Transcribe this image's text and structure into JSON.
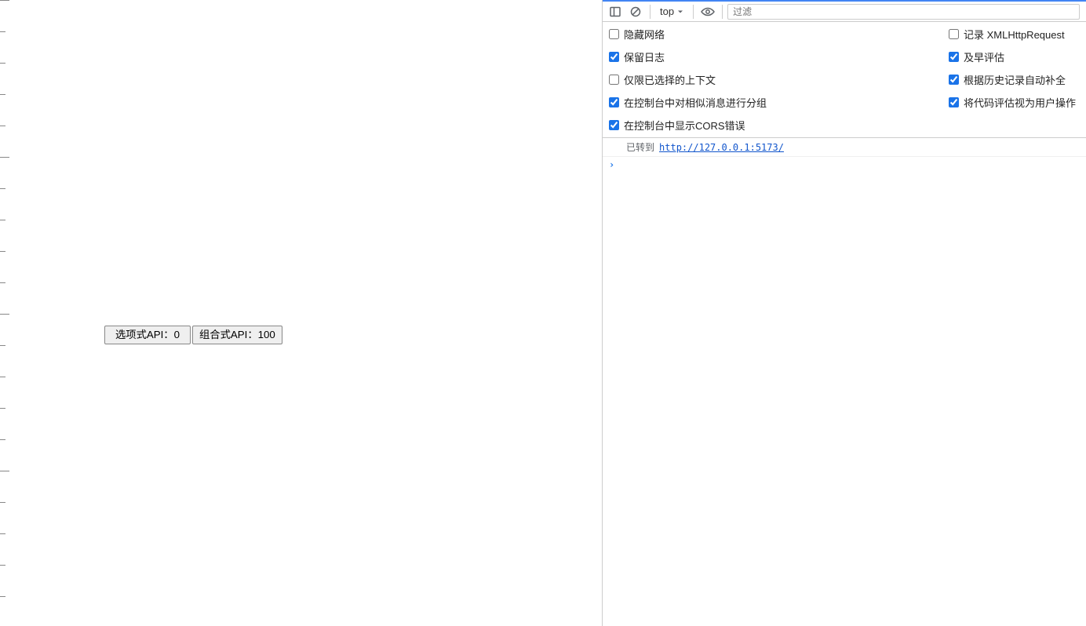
{
  "page": {
    "buttons": {
      "options_api": "选项式API：0",
      "composition_api": "组合式API：100"
    }
  },
  "devtools": {
    "toolbar": {
      "scope": "top",
      "filter_placeholder": "过滤"
    },
    "settings": {
      "hide_network": {
        "label": "隐藏网络",
        "checked": false
      },
      "log_xhr": {
        "label": "记录 XMLHttpRequest",
        "checked": false
      },
      "preserve_log": {
        "label": "保留日志",
        "checked": true
      },
      "eager_eval": {
        "label": "及早评估",
        "checked": true
      },
      "selected_ctx_only": {
        "label": "仅限已选择的上下文",
        "checked": false
      },
      "autocomplete_history": {
        "label": "根据历史记录自动补全",
        "checked": true
      },
      "group_similar": {
        "label": "在控制台中对相似消息进行分组",
        "checked": true
      },
      "user_gesture": {
        "label": "将代码评估视为用户操作",
        "checked": true
      },
      "show_cors": {
        "label": "在控制台中显示CORS错误",
        "checked": true
      }
    },
    "console": {
      "nav_prefix": "已转到",
      "nav_url": "http://127.0.0.1:5173/"
    }
  }
}
